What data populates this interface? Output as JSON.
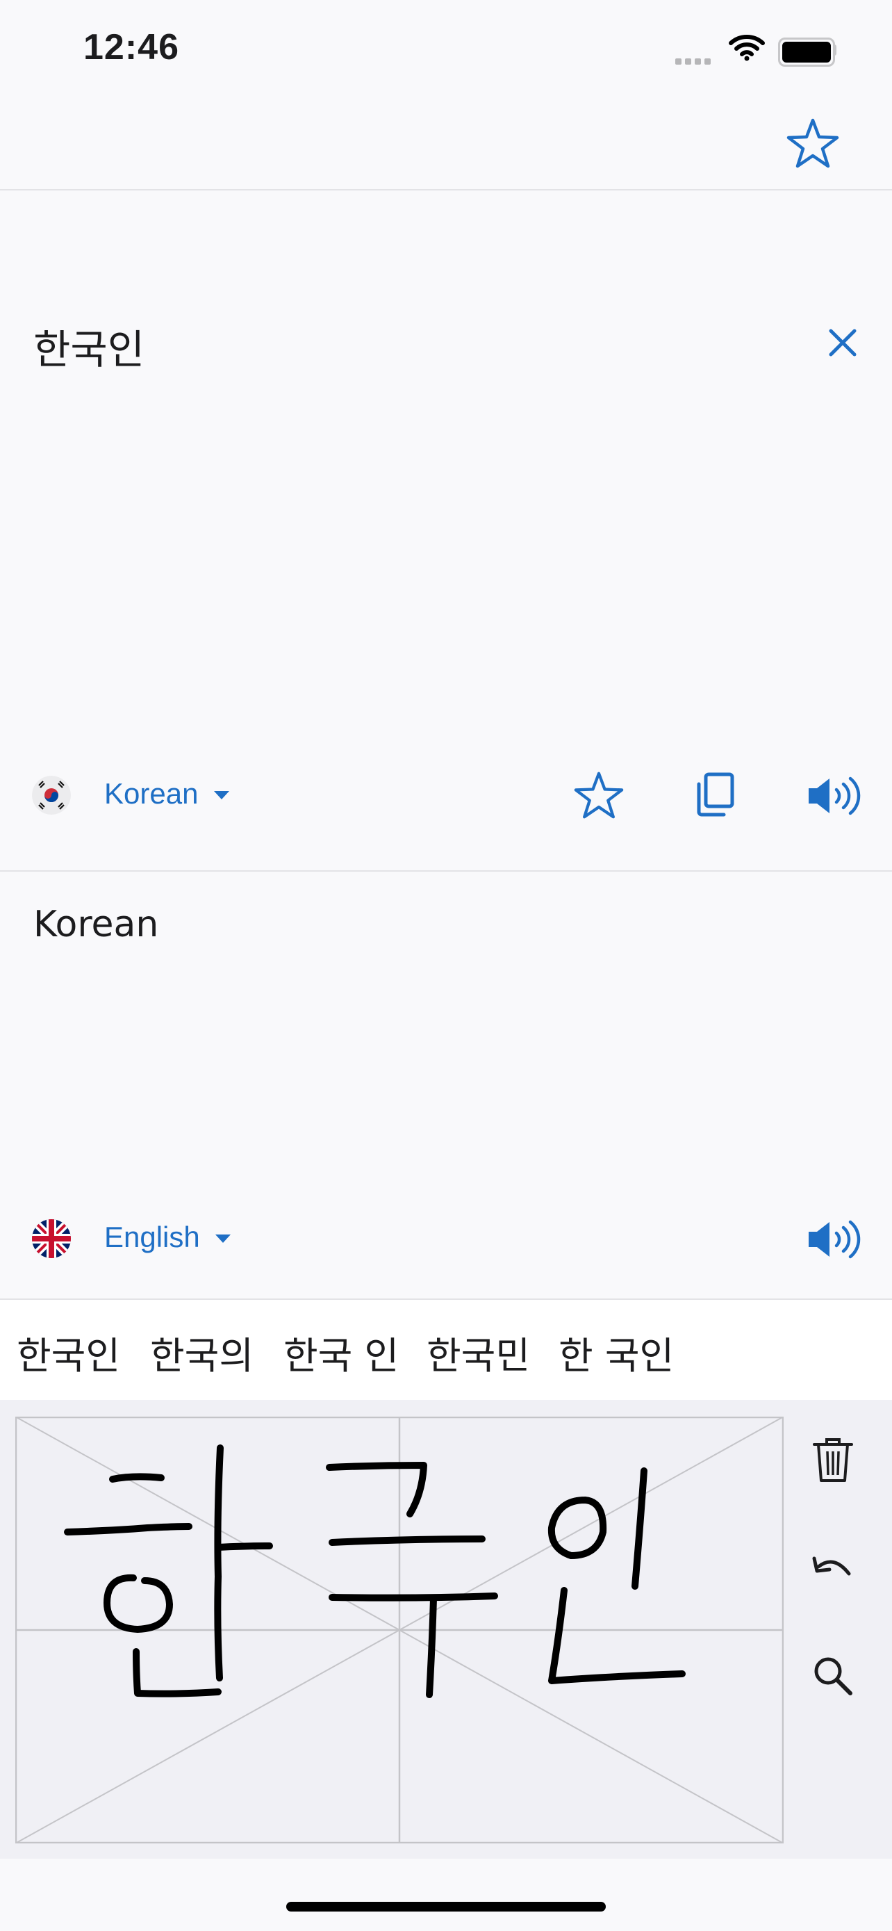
{
  "status_bar": {
    "time": "12:46"
  },
  "source": {
    "text": "한국인",
    "language": "Korean",
    "flag": "south-korea-flag"
  },
  "target": {
    "text": "Korean",
    "language": "English",
    "flag": "uk-flag"
  },
  "suggestions": [
    "한국인",
    "한국의",
    "한국 인",
    "한국민",
    "한 국인"
  ],
  "colors": {
    "accent": "#1f6fc5",
    "background": "#f9f9fb",
    "handwriting_background": "#f0f0f5",
    "ink": "#000000",
    "guide_lines": "#c4c4c8"
  },
  "icons": {
    "favorites": "star-icon",
    "clear": "close-icon",
    "copy": "copy-icon",
    "speak": "speaker-icon",
    "delete": "trash-icon",
    "undo": "undo-icon",
    "search": "search-icon"
  }
}
